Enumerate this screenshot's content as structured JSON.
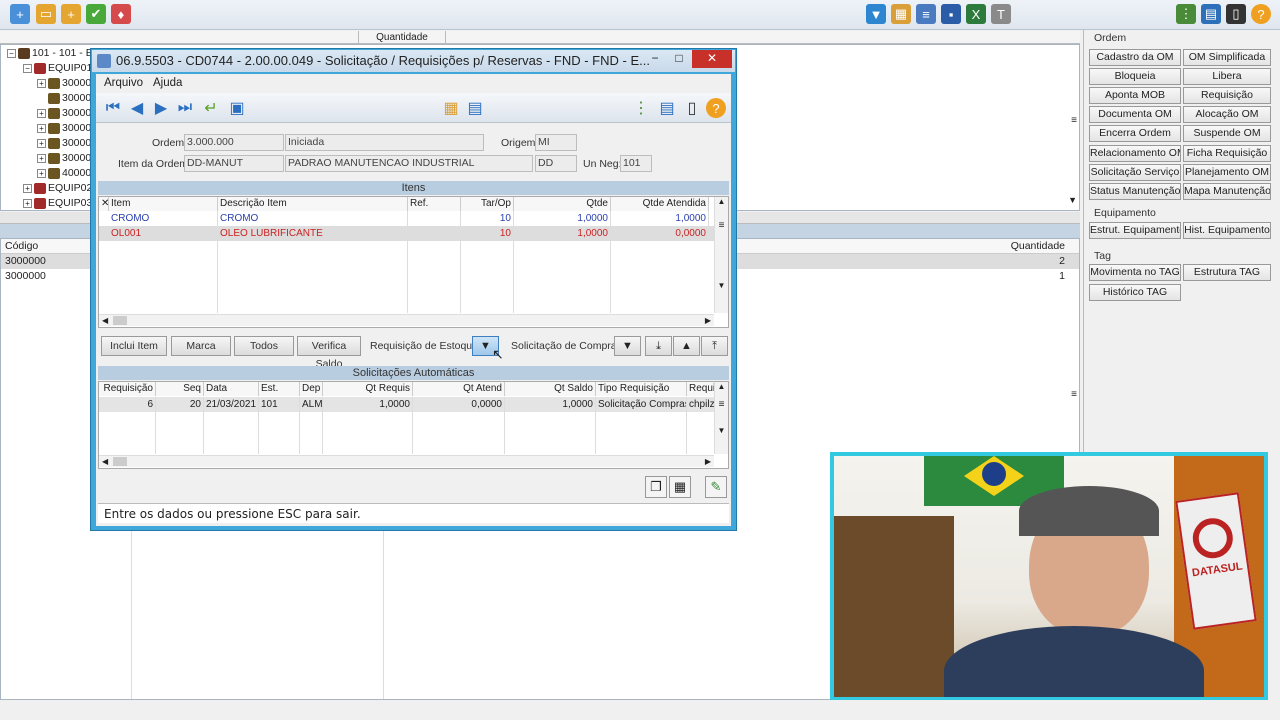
{
  "tree_header": {
    "quantidade": "Quantidade"
  },
  "tree": {
    "root": "101 - 101 - E",
    "nodes": [
      "EQUIP01",
      "30000",
      "30000",
      "30000",
      "30000",
      "30000",
      "30000",
      "40000",
      "EQUIP02",
      "EQUIP03"
    ]
  },
  "grid2": {
    "col_codigo": "Código",
    "col_quantidade": "Quantidade",
    "rows": [
      {
        "codigo": "3000000",
        "quantidade": "2"
      },
      {
        "codigo": "3000000",
        "quantidade": "1"
      }
    ]
  },
  "right_panel": {
    "ordem_label": "Ordem",
    "ordem_buttons": [
      "Cadastro da OM",
      "OM Simplificada",
      "Bloqueia",
      "Libera",
      "Aponta MOB",
      "Requisição",
      "Documenta OM",
      "Alocação OM",
      "Encerra Ordem",
      "Suspende OM",
      "Relacionamento OM",
      "Ficha Requisição",
      "Solicitação Serviço",
      "Planejamento OM",
      "Status Manutenção",
      "Mapa Manutenção"
    ],
    "equip_label": "Equipamento",
    "equip_buttons": [
      "Estrut. Equipamento",
      "Hist. Equipamento"
    ],
    "tag_label": "Tag",
    "tag_buttons": [
      "Movimenta no TAG",
      "Estrutura TAG",
      "Histórico TAG"
    ]
  },
  "dialog": {
    "title": "06.9.5503 - CD0744 - 2.00.00.049 - Solicitação / Requisições p/ Reservas - FND - FND - E...",
    "menu": {
      "arquivo": "Arquivo",
      "ajuda": "Ajuda"
    },
    "form": {
      "ordem_label": "Ordem:",
      "ordem_value": "3.000.000",
      "status_value": "Iniciada",
      "origem_label": "Origem:",
      "origem_value": "MI",
      "item_label": "Item da Ordem:",
      "item_code": "DD-MANUT",
      "item_desc": "PADRAO MANUTENCAO INDUSTRIAL",
      "item_unit": "DD",
      "unneg_label": "Un Neg:",
      "unneg_value": "101"
    },
    "itens": {
      "header": "Itens",
      "columns": [
        "Item",
        "Descrição Item",
        "Ref.",
        "Tar/Op",
        "Qtde",
        "Qtde Atendida"
      ],
      "rows": [
        {
          "item": "CROMO",
          "desc": "CROMO",
          "ref": "",
          "tarop": "10",
          "qtde": "1,0000",
          "atendida": "1,0000"
        },
        {
          "item": "OL001",
          "desc": "OLEO LUBRIFICANTE",
          "ref": "",
          "tarop": "10",
          "qtde": "1,0000",
          "atendida": "0,0000"
        }
      ]
    },
    "buttons": {
      "inclui": "Inclui Item",
      "marca": "Marca",
      "todos": "Todos",
      "verifica": "Verifica Saldo",
      "req_estoque": "Requisição de Estoque",
      "sol_compra": "Solicitação de Compra"
    },
    "auto": {
      "header": "Solicitações Automáticas",
      "columns": [
        "Requisição",
        "Seq",
        "Data",
        "Est.",
        "Dep",
        "Qt Requis",
        "Qt Atend",
        "Qt Saldo",
        "Tipo Requisição",
        "Requi"
      ],
      "rows": [
        {
          "req": "6",
          "seq": "20",
          "data": "21/03/2021",
          "est": "101",
          "dep": "ALM",
          "qtreq": "1,0000",
          "qtatend": "0,0000",
          "qtsaldo": "1,0000",
          "tipo": "Solicitação Compras",
          "requi": "chpilz"
        }
      ]
    },
    "status": "Entre os dados ou pressione ESC para sair."
  },
  "webcam": {
    "logo_text": "DATASUL"
  },
  "colors": {
    "accent": "#3fa7d9",
    "red_row": "#cc2222",
    "blue_row": "#2a3fb0"
  }
}
